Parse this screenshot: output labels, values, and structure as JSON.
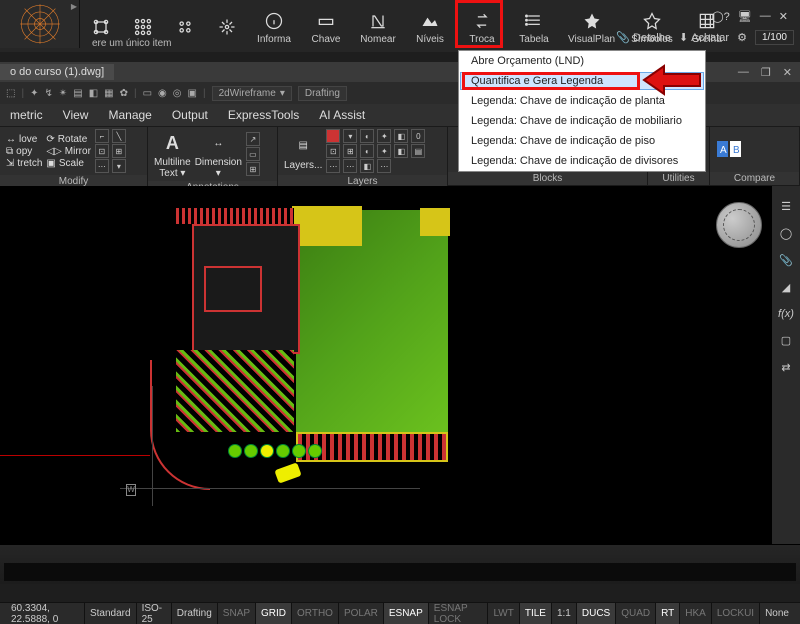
{
  "top": {
    "informa": "Informa",
    "chave": "Chave",
    "nomear": "Nomear",
    "niveis": "Níveis",
    "troca": "Troca",
    "tabela": "Tabela",
    "visualplan": "VisualPlan",
    "simbolos": "Símbolos",
    "grelha": "Grelha",
    "detalhe": "Detalhe",
    "achatar": "Achatar",
    "tip": "ere um único item",
    "scale": "1/100"
  },
  "doc": {
    "title": "o do curso (1).dwg]"
  },
  "mini": {
    "wf": "2dWireframe",
    "mode": "Drafting"
  },
  "menu": {
    "m0": "metric",
    "m1": "View",
    "m2": "Manage",
    "m3": "Output",
    "m4": "ExpressTools",
    "m5": "AI Assist"
  },
  "ribbon": {
    "modify": {
      "move": "love",
      "copy": "opy",
      "stretch": "tretch",
      "rotate": "Rotate",
      "mirror": "Mirror",
      "scale": "Scale",
      "title": "Modify"
    },
    "ann": {
      "ml": "Multiline",
      "mlt": "Text",
      "dim": "Dimension",
      "title": "Annotations"
    },
    "layers": {
      "btn": "Layers...",
      "title": "Layers"
    },
    "blocks": {
      "title": "Blocks"
    },
    "utilities": {
      "title": "Utilities"
    },
    "compare": {
      "title": "Compare"
    }
  },
  "popup": {
    "i0": "Abre Orçamento (LND)",
    "i1": "Quantifica e Gera Legenda",
    "i2": "Legenda: Chave de indicação de planta",
    "i3": "Legenda: Chave de indicação de mobiliario",
    "i4": "Legenda: Chave de indicação de piso",
    "i5": "Legenda: Chave de indicação de divisores"
  },
  "canvas": {
    "w": "W"
  },
  "status": {
    "coords": "60.3304, 22.5888, 0",
    "std": "Standard",
    "iso": "ISO-25",
    "draft": "Drafting",
    "snap": "SNAP",
    "grid": "GRID",
    "ortho": "ORTHO",
    "polar": "POLAR",
    "esnap": "ESNAP",
    "lock": "ESNAP LOCK",
    "lwt": "LWT",
    "tile": "TILE",
    "ratio": "1:1",
    "ducs": "DUCS",
    "quad": "QUAD",
    "rt": "RT",
    "hka": "HKA",
    "locku": "LOCKUI",
    "none": "None"
  }
}
